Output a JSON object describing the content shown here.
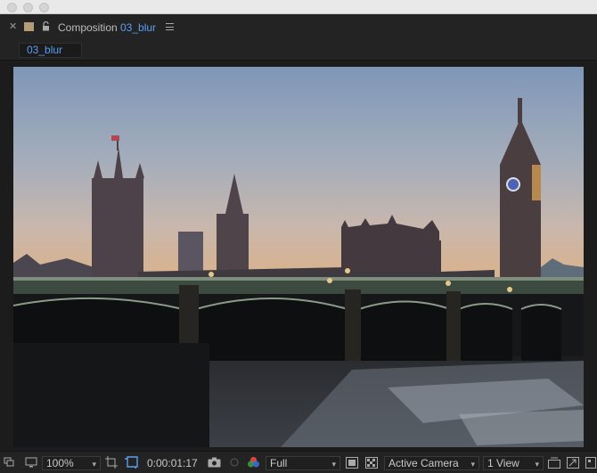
{
  "panel": {
    "label": "Composition",
    "name": "03_blur",
    "tab_label": "03_blur",
    "label_color": "#b59c79"
  },
  "statusbar": {
    "zoom": "100%",
    "timecode": "0:00:01:17",
    "resolution": "Full",
    "camera": "Active Camera",
    "views": "1 View"
  },
  "icons": {
    "close": "close-icon",
    "lock": "lock-icon",
    "menu": "panel-menu-icon",
    "snapshot": "camera-snapshot-icon",
    "color": "channel-color-icon"
  },
  "colors": {
    "accent": "#5a9ef0",
    "panel_bg": "#232323"
  }
}
